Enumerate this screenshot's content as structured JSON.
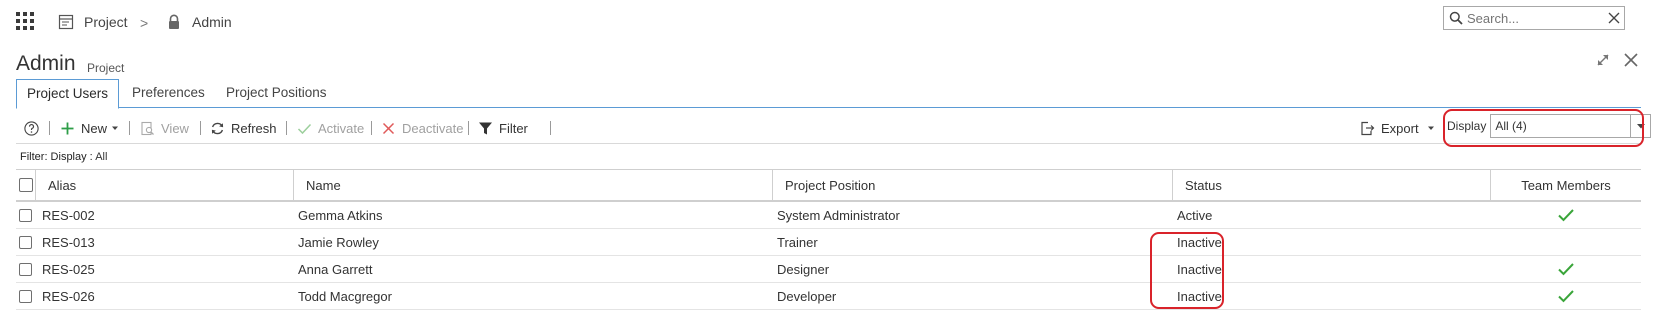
{
  "topbar": {
    "breadcrumb": [
      {
        "label": "Project",
        "icon": "project-icon"
      },
      {
        "label": "Admin",
        "icon": "lock-icon"
      }
    ],
    "breadcrumb_separator": ">",
    "search": {
      "value": "",
      "placeholder": "Search..."
    }
  },
  "page": {
    "title": "Admin",
    "subtitle": "Project"
  },
  "tabs": [
    {
      "label": "Project Users",
      "active": true
    },
    {
      "label": "Preferences",
      "active": false
    },
    {
      "label": "Project Positions",
      "active": false
    }
  ],
  "toolbar": {
    "new_label": "New",
    "view_label": "View",
    "refresh_label": "Refresh",
    "activate_label": "Activate",
    "deactivate_label": "Deactivate",
    "filter_label": "Filter",
    "export_label": "Export",
    "display_label": "Display",
    "display_value": "All (4)"
  },
  "filter_info": {
    "prefix": "Filter: Display :",
    "value": "All"
  },
  "grid": {
    "columns": [
      "Alias",
      "Name",
      "Project Position",
      "Status",
      "Team Members"
    ],
    "rows": [
      {
        "alias": "RES-002",
        "name": "Gemma Atkins",
        "position": "System Administrator",
        "status": "Active",
        "team_member": true
      },
      {
        "alias": "RES-013",
        "name": "Jamie Rowley",
        "position": "Trainer",
        "status": "Inactive",
        "team_member": false
      },
      {
        "alias": "RES-025",
        "name": "Anna Garrett",
        "position": "Designer",
        "status": "Inactive",
        "team_member": true
      },
      {
        "alias": "RES-026",
        "name": "Todd Macgregor",
        "position": "Developer",
        "status": "Inactive",
        "team_member": true
      }
    ]
  },
  "colors": {
    "accent_blue": "#5b9bd5",
    "highlight_red": "#d9232a",
    "check_green": "#3aa53a",
    "new_plus_green": "#2e9e48",
    "deactivate_red": "#e05a5a"
  }
}
